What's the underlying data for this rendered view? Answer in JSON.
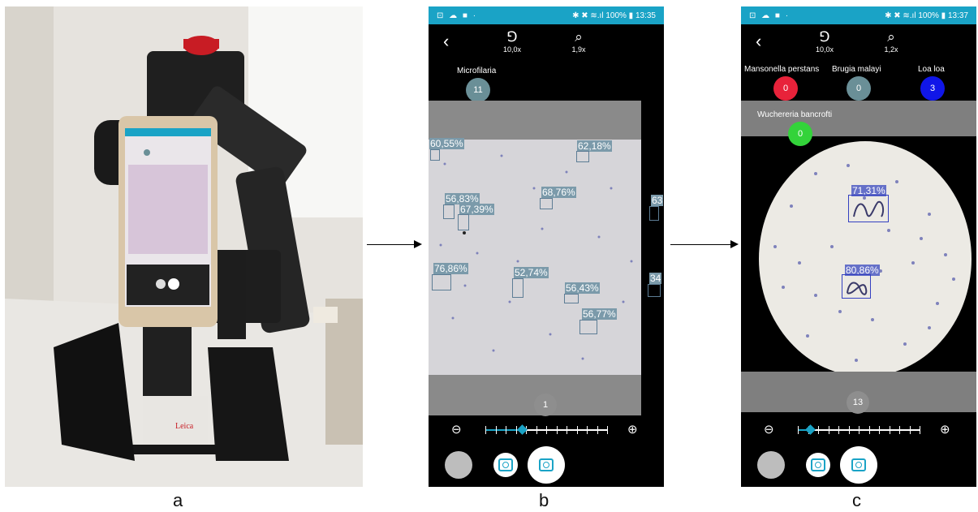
{
  "panels": {
    "a": {
      "label": "a"
    },
    "b": {
      "label": "b",
      "status": {
        "icons": "⊡ ☁ ■ ·",
        "right": "✱ ✖ ≋.ıl 100% ▮ 13:35"
      },
      "topbar": {
        "magnification": "10,0x",
        "zoom": "1,9x"
      },
      "counter": {
        "label": "Microfilaria",
        "value": "11",
        "color": "#6a8f97"
      },
      "detections": [
        "60,55%",
        "62,18%",
        "56,83%",
        "67,39%",
        "68,76%",
        "63",
        "76,86%",
        "52,74%",
        "56,43%",
        "34",
        "56,77%"
      ],
      "frame_counter": "1",
      "slider_level": 0.3
    },
    "c": {
      "label": "c",
      "status": {
        "icons": "⊡ ☁ ■ ·",
        "right": "✱ ✖ ≋.ıl 100% ▮ 13:37"
      },
      "topbar": {
        "magnification": "10,0x",
        "zoom": "1,2x"
      },
      "counters": [
        {
          "label": "Mansonella perstans",
          "value": "0",
          "color": "#e8223a"
        },
        {
          "label": "Brugia malayi",
          "value": "0",
          "color": "#6a8f97"
        },
        {
          "label": "Loa loa",
          "value": "3",
          "color": "#1016e8"
        },
        {
          "label": "Wuchereria bancrofti",
          "value": "0",
          "color": "#33d33a"
        }
      ],
      "detections": [
        "71,31%",
        "80,86%"
      ],
      "frame_counter": "13",
      "slider_level": 0.1
    }
  },
  "icons": {
    "back": "chevron-left-icon",
    "microscope": "microscope-icon",
    "search": "magnifier-icon",
    "zoom_out": "zoom-out-icon",
    "zoom_in": "zoom-in-icon",
    "camera": "camera-icon"
  }
}
